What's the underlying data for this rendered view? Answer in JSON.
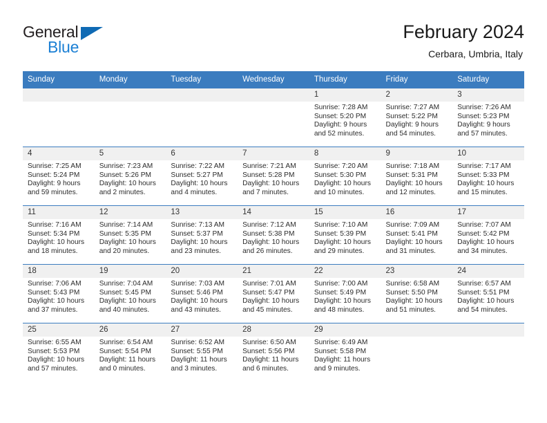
{
  "brand": {
    "line1": "General",
    "line2": "Blue",
    "triangle_color": "#0f6ab4",
    "line2_color": "#1b7fd4"
  },
  "header": {
    "title": "February 2024",
    "subtitle": "Cerbara, Umbria, Italy"
  },
  "theme": {
    "header_bg": "#3b7cbf",
    "header_text": "#ffffff",
    "daynum_bg": "#f0f0f0",
    "grid_line": "#3b7cbf",
    "body_text": "#2b2b2b"
  },
  "weekdays": [
    "Sunday",
    "Monday",
    "Tuesday",
    "Wednesday",
    "Thursday",
    "Friday",
    "Saturday"
  ],
  "labels": {
    "sunrise_prefix": "Sunrise:",
    "sunset_prefix": "Sunset:",
    "daylight_prefix": "Daylight:"
  },
  "weeks": [
    [
      {
        "day": "",
        "sunrise": "",
        "sunset": "",
        "daylight1": "",
        "daylight2": ""
      },
      {
        "day": "",
        "sunrise": "",
        "sunset": "",
        "daylight1": "",
        "daylight2": ""
      },
      {
        "day": "",
        "sunrise": "",
        "sunset": "",
        "daylight1": "",
        "daylight2": ""
      },
      {
        "day": "",
        "sunrise": "",
        "sunset": "",
        "daylight1": "",
        "daylight2": ""
      },
      {
        "day": "1",
        "sunrise": "Sunrise: 7:28 AM",
        "sunset": "Sunset: 5:20 PM",
        "daylight1": "Daylight: 9 hours",
        "daylight2": "and 52 minutes."
      },
      {
        "day": "2",
        "sunrise": "Sunrise: 7:27 AM",
        "sunset": "Sunset: 5:22 PM",
        "daylight1": "Daylight: 9 hours",
        "daylight2": "and 54 minutes."
      },
      {
        "day": "3",
        "sunrise": "Sunrise: 7:26 AM",
        "sunset": "Sunset: 5:23 PM",
        "daylight1": "Daylight: 9 hours",
        "daylight2": "and 57 minutes."
      }
    ],
    [
      {
        "day": "4",
        "sunrise": "Sunrise: 7:25 AM",
        "sunset": "Sunset: 5:24 PM",
        "daylight1": "Daylight: 9 hours",
        "daylight2": "and 59 minutes."
      },
      {
        "day": "5",
        "sunrise": "Sunrise: 7:23 AM",
        "sunset": "Sunset: 5:26 PM",
        "daylight1": "Daylight: 10 hours",
        "daylight2": "and 2 minutes."
      },
      {
        "day": "6",
        "sunrise": "Sunrise: 7:22 AM",
        "sunset": "Sunset: 5:27 PM",
        "daylight1": "Daylight: 10 hours",
        "daylight2": "and 4 minutes."
      },
      {
        "day": "7",
        "sunrise": "Sunrise: 7:21 AM",
        "sunset": "Sunset: 5:28 PM",
        "daylight1": "Daylight: 10 hours",
        "daylight2": "and 7 minutes."
      },
      {
        "day": "8",
        "sunrise": "Sunrise: 7:20 AM",
        "sunset": "Sunset: 5:30 PM",
        "daylight1": "Daylight: 10 hours",
        "daylight2": "and 10 minutes."
      },
      {
        "day": "9",
        "sunrise": "Sunrise: 7:18 AM",
        "sunset": "Sunset: 5:31 PM",
        "daylight1": "Daylight: 10 hours",
        "daylight2": "and 12 minutes."
      },
      {
        "day": "10",
        "sunrise": "Sunrise: 7:17 AM",
        "sunset": "Sunset: 5:33 PM",
        "daylight1": "Daylight: 10 hours",
        "daylight2": "and 15 minutes."
      }
    ],
    [
      {
        "day": "11",
        "sunrise": "Sunrise: 7:16 AM",
        "sunset": "Sunset: 5:34 PM",
        "daylight1": "Daylight: 10 hours",
        "daylight2": "and 18 minutes."
      },
      {
        "day": "12",
        "sunrise": "Sunrise: 7:14 AM",
        "sunset": "Sunset: 5:35 PM",
        "daylight1": "Daylight: 10 hours",
        "daylight2": "and 20 minutes."
      },
      {
        "day": "13",
        "sunrise": "Sunrise: 7:13 AM",
        "sunset": "Sunset: 5:37 PM",
        "daylight1": "Daylight: 10 hours",
        "daylight2": "and 23 minutes."
      },
      {
        "day": "14",
        "sunrise": "Sunrise: 7:12 AM",
        "sunset": "Sunset: 5:38 PM",
        "daylight1": "Daylight: 10 hours",
        "daylight2": "and 26 minutes."
      },
      {
        "day": "15",
        "sunrise": "Sunrise: 7:10 AM",
        "sunset": "Sunset: 5:39 PM",
        "daylight1": "Daylight: 10 hours",
        "daylight2": "and 29 minutes."
      },
      {
        "day": "16",
        "sunrise": "Sunrise: 7:09 AM",
        "sunset": "Sunset: 5:41 PM",
        "daylight1": "Daylight: 10 hours",
        "daylight2": "and 31 minutes."
      },
      {
        "day": "17",
        "sunrise": "Sunrise: 7:07 AM",
        "sunset": "Sunset: 5:42 PM",
        "daylight1": "Daylight: 10 hours",
        "daylight2": "and 34 minutes."
      }
    ],
    [
      {
        "day": "18",
        "sunrise": "Sunrise: 7:06 AM",
        "sunset": "Sunset: 5:43 PM",
        "daylight1": "Daylight: 10 hours",
        "daylight2": "and 37 minutes."
      },
      {
        "day": "19",
        "sunrise": "Sunrise: 7:04 AM",
        "sunset": "Sunset: 5:45 PM",
        "daylight1": "Daylight: 10 hours",
        "daylight2": "and 40 minutes."
      },
      {
        "day": "20",
        "sunrise": "Sunrise: 7:03 AM",
        "sunset": "Sunset: 5:46 PM",
        "daylight1": "Daylight: 10 hours",
        "daylight2": "and 43 minutes."
      },
      {
        "day": "21",
        "sunrise": "Sunrise: 7:01 AM",
        "sunset": "Sunset: 5:47 PM",
        "daylight1": "Daylight: 10 hours",
        "daylight2": "and 45 minutes."
      },
      {
        "day": "22",
        "sunrise": "Sunrise: 7:00 AM",
        "sunset": "Sunset: 5:49 PM",
        "daylight1": "Daylight: 10 hours",
        "daylight2": "and 48 minutes."
      },
      {
        "day": "23",
        "sunrise": "Sunrise: 6:58 AM",
        "sunset": "Sunset: 5:50 PM",
        "daylight1": "Daylight: 10 hours",
        "daylight2": "and 51 minutes."
      },
      {
        "day": "24",
        "sunrise": "Sunrise: 6:57 AM",
        "sunset": "Sunset: 5:51 PM",
        "daylight1": "Daylight: 10 hours",
        "daylight2": "and 54 minutes."
      }
    ],
    [
      {
        "day": "25",
        "sunrise": "Sunrise: 6:55 AM",
        "sunset": "Sunset: 5:53 PM",
        "daylight1": "Daylight: 10 hours",
        "daylight2": "and 57 minutes."
      },
      {
        "day": "26",
        "sunrise": "Sunrise: 6:54 AM",
        "sunset": "Sunset: 5:54 PM",
        "daylight1": "Daylight: 11 hours",
        "daylight2": "and 0 minutes."
      },
      {
        "day": "27",
        "sunrise": "Sunrise: 6:52 AM",
        "sunset": "Sunset: 5:55 PM",
        "daylight1": "Daylight: 11 hours",
        "daylight2": "and 3 minutes."
      },
      {
        "day": "28",
        "sunrise": "Sunrise: 6:50 AM",
        "sunset": "Sunset: 5:56 PM",
        "daylight1": "Daylight: 11 hours",
        "daylight2": "and 6 minutes."
      },
      {
        "day": "29",
        "sunrise": "Sunrise: 6:49 AM",
        "sunset": "Sunset: 5:58 PM",
        "daylight1": "Daylight: 11 hours",
        "daylight2": "and 9 minutes."
      },
      {
        "day": "",
        "sunrise": "",
        "sunset": "",
        "daylight1": "",
        "daylight2": ""
      },
      {
        "day": "",
        "sunrise": "",
        "sunset": "",
        "daylight1": "",
        "daylight2": ""
      }
    ]
  ]
}
